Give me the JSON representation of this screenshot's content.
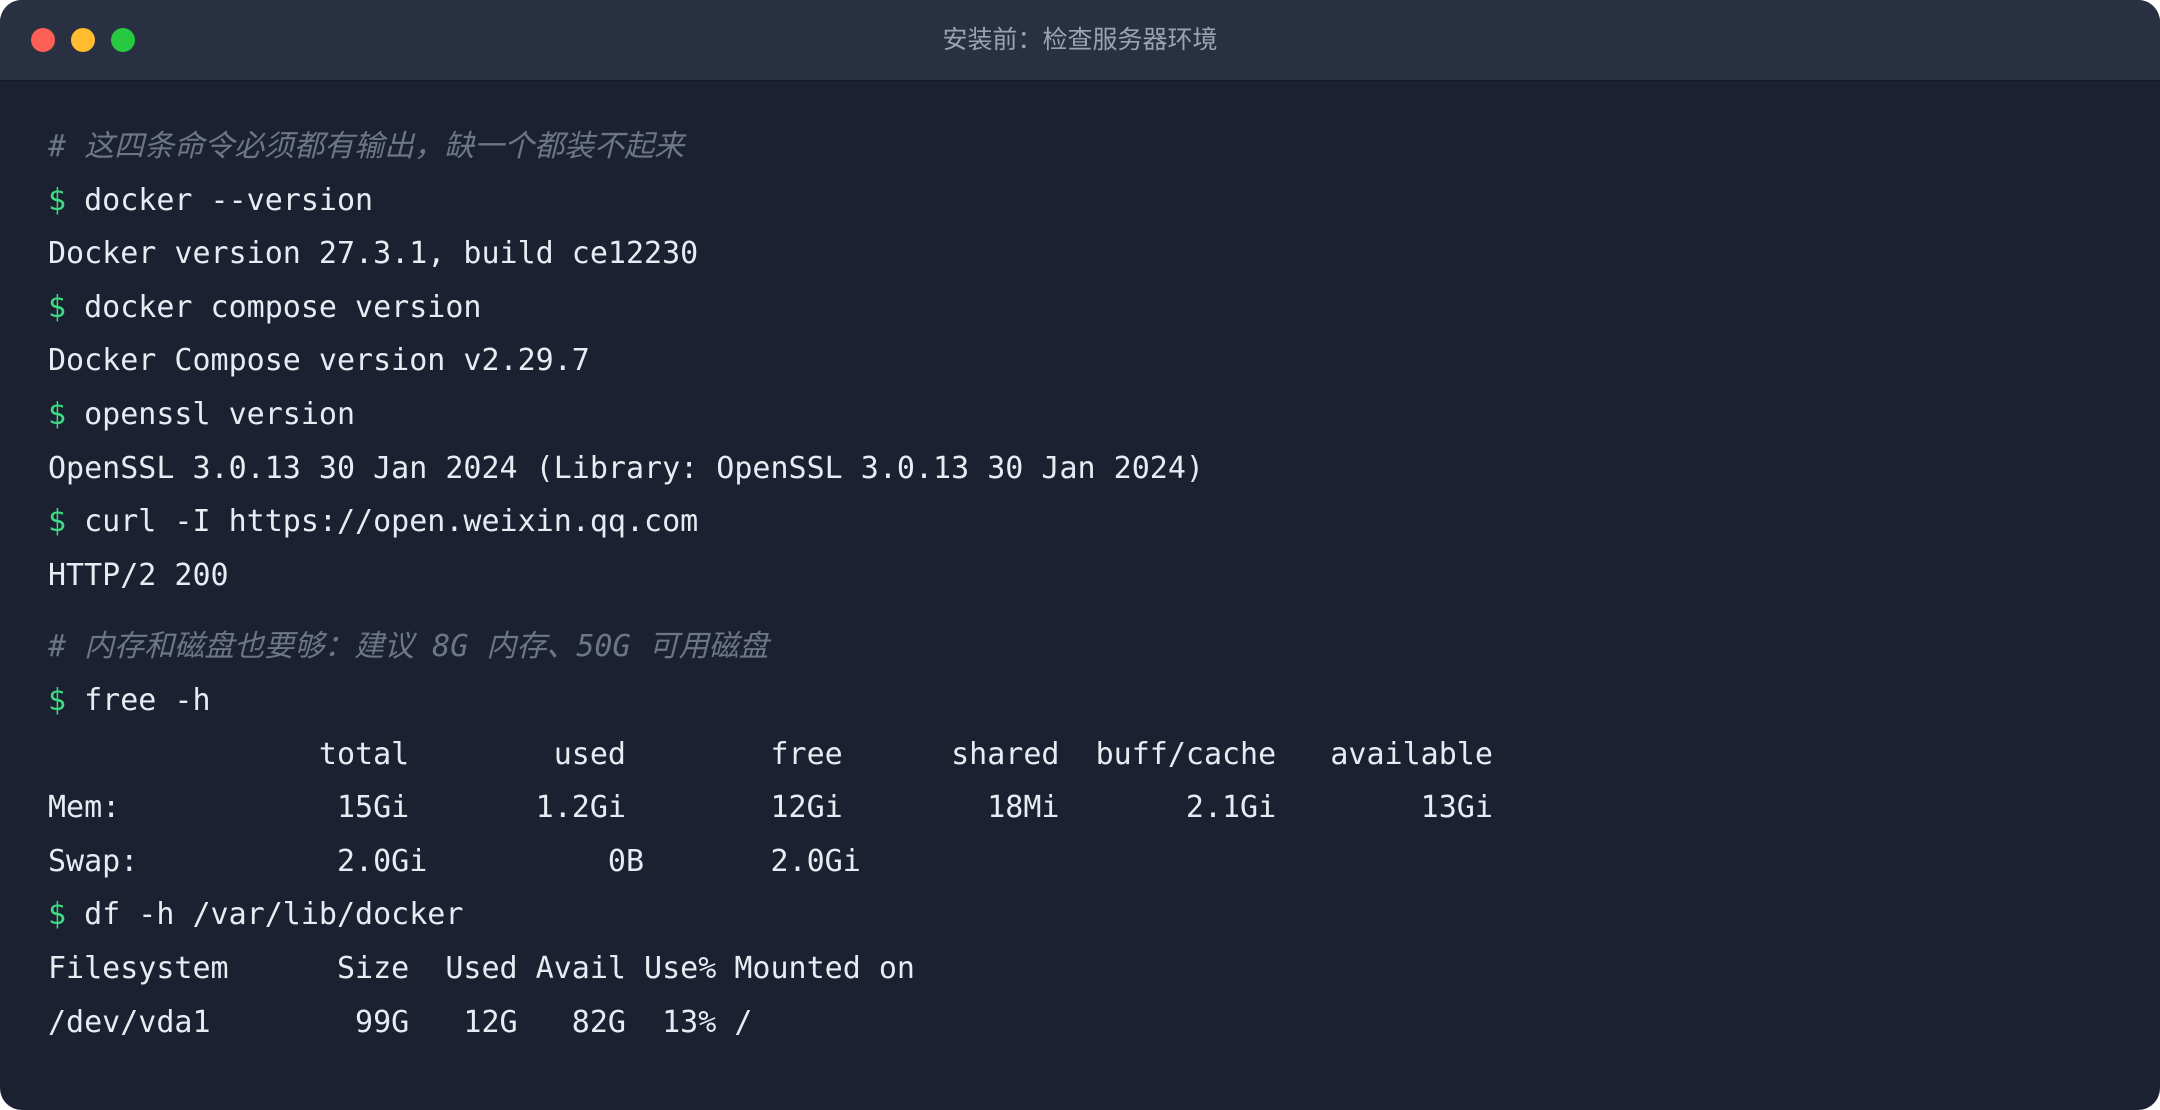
{
  "window": {
    "title": "安装前：检查服务器环境"
  },
  "colors": {
    "background": "#1b2130",
    "titlebar": "#293042",
    "text": "#e8ecf2",
    "comment": "#6d7689",
    "prompt": "#3ddc84"
  },
  "terminal": {
    "comment1": "# 这四条命令必须都有输出，缺一个都装不起来",
    "prompt_symbol": "$",
    "cmd_docker_version": "docker --version",
    "out_docker_version": "Docker version 27.3.1, build ce12230",
    "cmd_compose_version": "docker compose version",
    "out_compose_version": "Docker Compose version v2.29.7",
    "cmd_openssl_version": "openssl version",
    "out_openssl_version": "OpenSSL 3.0.13 30 Jan 2024 (Library: OpenSSL 3.0.13 30 Jan 2024)",
    "cmd_curl": "curl -I https://open.weixin.qq.com",
    "out_curl": "HTTP/2 200",
    "comment2": "# 内存和磁盘也要够：建议 8G 内存、50G 可用磁盘",
    "cmd_free": "free -h",
    "free_header": "               total        used        free      shared  buff/cache   available",
    "free_mem": "Mem:            15Gi       1.2Gi        12Gi        18Mi       2.1Gi        13Gi",
    "free_swap": "Swap:           2.0Gi          0B       2.0Gi",
    "cmd_df": "df -h /var/lib/docker",
    "df_header": "Filesystem      Size  Used Avail Use% Mounted on",
    "df_row": "/dev/vda1        99G   12G   82G  13% /"
  }
}
